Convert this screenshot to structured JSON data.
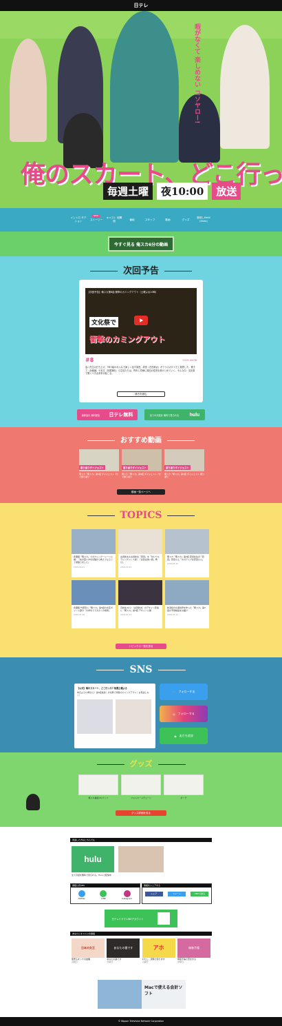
{
  "topbar": {
    "brand": "日テレ"
  },
  "hero": {
    "title": "俺のスカート、どこ行った?",
    "air_day": "毎週土曜",
    "air_time": "夜10:00",
    "air_label": "放送",
    "catch": "暇がなくて 楽しめない コソヤロー!"
  },
  "nav": {
    "items": [
      {
        "label": "イントロ ダクション"
      },
      {
        "label": "ストーリー",
        "badge": "NEW"
      },
      {
        "label": "キャスト 相関図"
      },
      {
        "label": "番組"
      },
      {
        "label": "スタッフ"
      },
      {
        "label": "動画"
      },
      {
        "label": "グッズ"
      },
      {
        "label": "登録しMeW (Meta)"
      }
    ]
  },
  "banner": {
    "label": "今すぐ見る 俺スカ6分の動画"
  },
  "next": {
    "heading": "次回予告",
    "video_title": "【次回予告】俺スカ第8話 衝撃のカミングアウト（土曜よる10時）",
    "caption_1": "文化祭で",
    "caption_2": "衝撃のカミングアウト",
    "episode": "#8",
    "date": "2019.06.08",
    "synopsis": "金八先生の打ち上げ、3年3組のみんなで楽しく話す原田。原田（古田新太）がクラスのゲイだと発表した。驚きで（永瀬廉）や本庄（長尾謙杜）ら生徒たちは、昨年と同様に原田の性別を受けとめていく。そんな中、文化祭で驚くべき出来事が起こる。",
    "more": "続きを読む",
    "pill_left_label": "最新話を 無料配信",
    "pill_left_brand": "日テレ無料",
    "pill_right_label": "全てのお話を 無料で見られる",
    "pill_right_brand": "hulu"
  },
  "videos": {
    "heading": "おすすめ動画",
    "items": [
      {
        "tag": "振り返りダイジェスト",
        "caption": "俺スカ「俺スカ」第5話 ダイジェスト 7分で振り返り"
      },
      {
        "tag": "振り返りダイジェスト",
        "caption": "俺スカ「俺スカ」第6話 ダイジェスト 7分で振り返り"
      },
      {
        "tag": "振り返りダイジェスト",
        "caption": "俺スカ「俺スカ」第5話 ダイジェスト 振り返り"
      }
    ],
    "more": "動画一覧ページへ"
  },
  "topics": {
    "heading": "TOPICS",
    "cards": [
      {
        "text": "永瀬廉「俺スカ」でボクシング一シーン公開！「先の回い方を基礎から教えてもらって頑張りました」",
        "date": "2019.06.01"
      },
      {
        "text": "古田新太＆古田新太「原田」を「甘いウエディングドレス姿！「白目は素い姿」再び」",
        "date": "2019.05.25"
      },
      {
        "text": "俺スカ「俺スカ」第5話 原田先生の「原田」原田さん「ネガティブな原田さん」",
        "date": "2019.05.20"
      },
      {
        "text": "永瀬廉 竹葉真斗「俺スカ」第5話の文芸ポイント部分「大学をでで大きくの場所」",
        "date": "2019.05.18"
      },
      {
        "text": "高校生3人と（古田新太）のデザイン原宿に「俺スカ」第3話 デザイン公開",
        "date": "2019.05.14"
      },
      {
        "text": "新潟県の久保世界を作った「俺スカ」第2話の予告動画をお届け",
        "date": "2019.05.11"
      }
    ],
    "more": "トピックス一覧を見る"
  },
  "sns": {
    "heading": "SNS",
    "tweet_name": "【公式】俺のスカート、どこ行った? 毎週土曜よる",
    "tweet_text": "本日よる10時から！第8話放送！文化祭で衝撃のカミングアウト！お見逃しなく！",
    "twitter_label": "フォローする",
    "instagram_label": "フォローする",
    "line_label": "友だち追加"
  },
  "goods": {
    "heading": "グッズ",
    "items": [
      {
        "caption": "俺スカ番組 PVパンフ"
      },
      {
        "caption": "フォトカードチェーン"
      },
      {
        "caption": "ポーチ"
      }
    ],
    "more": "グッズ詳細を見る"
  },
  "footer": {
    "hulu_bar": "見逃した方はこちらでも",
    "hulu_label": "hulu",
    "hulu_caption": "全ての話を無料で見られる。Huluで配信中",
    "share_bar_left": "番組公式SNS",
    "share_bar_right": "番組をシェアする",
    "share_twitter": "Twitter",
    "share_line": "LINE",
    "share_instagram": "Instagram",
    "share_btn": "シェア",
    "tweet_btn": "ツイート",
    "line_send": "LINEで送る",
    "line_account": "日テレドラマ LINEアカウント",
    "recommend_bar": "あなたにオススメの番組",
    "recommends": [
      {
        "title": "家売るオンナの逆襲",
        "sub": "月曜日",
        "label": "日本の女王"
      },
      {
        "title": "あなたの番です",
        "sub": "日曜日",
        "label": "あなたの番です"
      },
      {
        "title": "わたし、定時で帰ります",
        "sub": "火曜日",
        "label": "アホ"
      },
      {
        "title": "偽装不倫で恋をする",
        "sub": "水曜日",
        "label": "偽装不倫"
      }
    ],
    "ad_label": "Macで使える会計ソフト"
  },
  "copyright": "© Nippon Television Network Corporation",
  "colors": {
    "hero": "#8dd258",
    "nav": "#3aaac4",
    "next": "#6fd3e0",
    "videos": "#ef7970",
    "topics": "#f9e070",
    "sns": "#3b8db1",
    "goods": "#7fd66e",
    "accent": "#e84b8a"
  }
}
